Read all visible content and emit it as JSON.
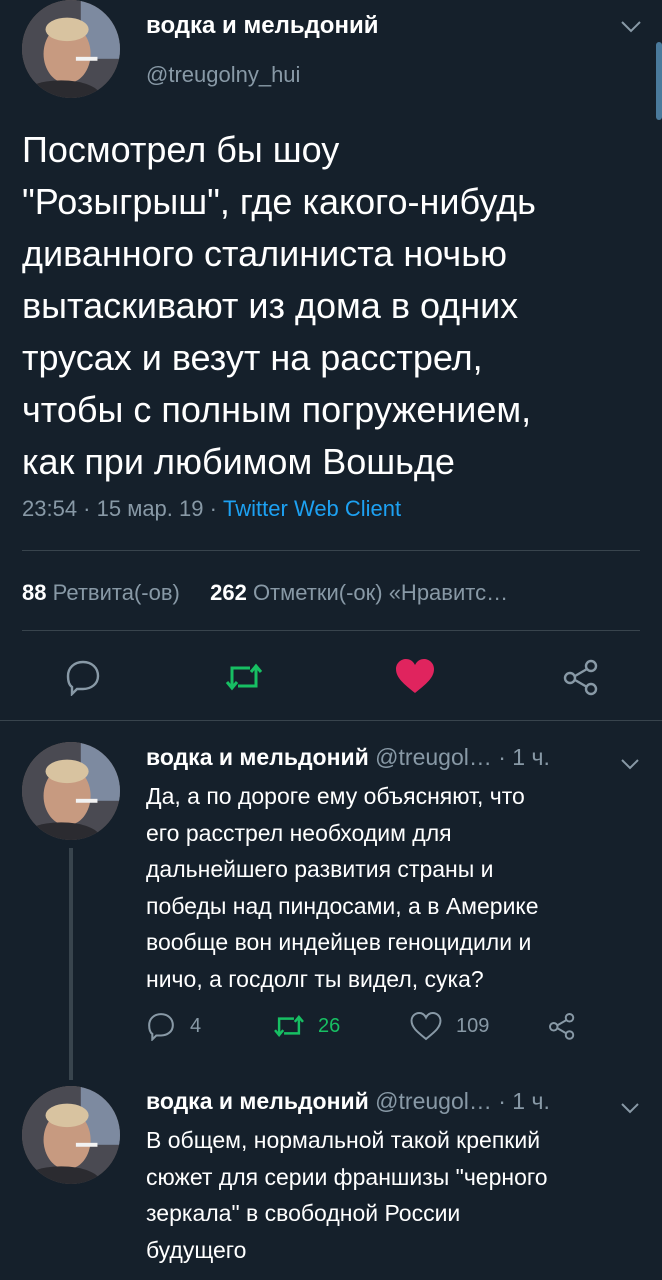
{
  "main_tweet": {
    "author_name": "водка и мельдоний",
    "handle": "@treugolny_hui",
    "text_lines": [
      "Посмотрел бы шоу",
      "\"Розыгрыш\", где какого-нибудь",
      "диванного сталиниста ночью",
      "вытаскивают из дома в одних",
      "трусах и везут на расстрел,",
      "чтобы с полным погружением,",
      "как при любимом Вошьде"
    ],
    "meta_time": "23:54 · 15 мар. 19 ·",
    "meta_client": "Twitter Web Client",
    "retweets_count": "88",
    "retweets_label": "Ретвита(-ов)",
    "likes_count": "262",
    "likes_label": "Отметки(-ок) «Нравитс…"
  },
  "replies": [
    {
      "author_name": "водка и мельдоний",
      "handle_time": "@treugol… · 1 ч.",
      "text_lines": [
        "Да, а по дороге ему объясняют, что",
        "его расстрел необходим для",
        "дальнейшего развития страны и",
        "победы над пиндосами, а в Америке",
        "вообще вон индейцев геноцидили и",
        "ничо, а госдолг ты видел, сука?"
      ],
      "reply_count": "4",
      "retweet_count": "26",
      "like_count": "109"
    },
    {
      "author_name": "водка и мельдоний",
      "handle_time": "@treugol… · 1 ч.",
      "text_lines": [
        "В общем, нормальной такой крепкий",
        "сюжет для серии франшизы \"черного",
        "зеркала\" в свободной России",
        "будущего"
      ]
    }
  ],
  "colors": {
    "background": "#15202b",
    "muted": "#8899a6",
    "link": "#1da1f2",
    "retweet": "#17bf63",
    "like": "#e0245e"
  }
}
